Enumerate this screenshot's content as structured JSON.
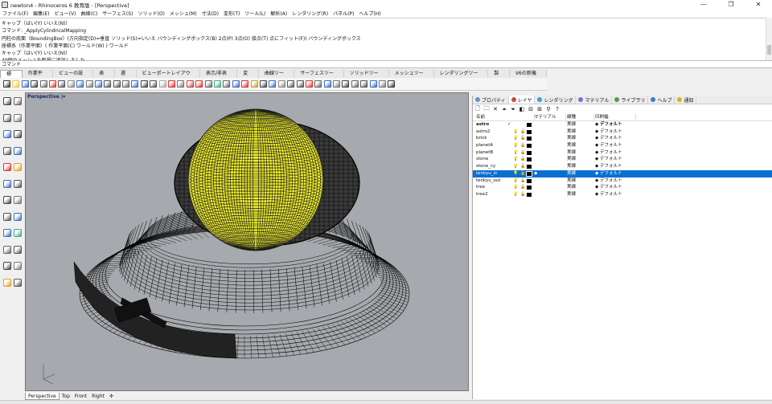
{
  "window": {
    "title": "newton4 - Rhinoceros 6 教育版 - [Perspective]",
    "controls": [
      "—",
      "❐",
      "✕"
    ]
  },
  "menu": [
    "ファイル(F)",
    "編集(E)",
    "ビュー(V)",
    "曲線(C)",
    "サーフェス(S)",
    "ソリッド(O)",
    "メッシュ(M)",
    "寸法(D)",
    "変形(T)",
    "ツール(L)",
    "解析(A)",
    "レンダリング(R)",
    "パネル(P)",
    "ヘルプ(H)"
  ],
  "command_history": [
    "キャップ（はい(Y) いいえ(N)）",
    "コマンド: _ApplyCylindricalMapping",
    "円柱の底面（BoundingBox）(方向指定(D)=垂直 ソリッド(S)=いいえ バウンディングボックス(B) 2点(P) 3点(O) 接点(T) 点にフィット(F)) バウンディングボックス",
    "座標系（作業平面）( 作業平面(C) ワールド(W) ) ワールド",
    "キャップ（はい(Y) いいえ(N)）",
    "49個のメッシュを新規に追加しました。"
  ],
  "command_prompt": "コマンド",
  "toolbar_tabs": [
    {
      "label": "標準",
      "active": true
    },
    {
      "label": "作業平面"
    },
    {
      "label": "ビューの設定"
    },
    {
      "label": "表示"
    },
    {
      "label": "選択"
    },
    {
      "label": "ビューポートレイアウト"
    },
    {
      "label": "表示/非表示"
    },
    {
      "label": "変形"
    },
    {
      "label": "曲線ツール"
    },
    {
      "label": "サーフェスツール"
    },
    {
      "label": "ソリッドツール"
    },
    {
      "label": "メッシュツール"
    },
    {
      "label": "レンダリングツール"
    },
    {
      "label": "製図"
    },
    {
      "label": "V6の新機能"
    }
  ],
  "viewport": {
    "label": "Perspective |▾",
    "tabs": [
      {
        "label": "Perspective",
        "active": true
      },
      {
        "label": "Top"
      },
      {
        "label": "Front"
      },
      {
        "label": "Right"
      },
      {
        "label": "✣"
      }
    ]
  },
  "panel": {
    "tabs": [
      {
        "label": "プロパティ",
        "color": "#6a8fc8"
      },
      {
        "label": "レイヤ",
        "color": "#d24a3a",
        "active": true
      },
      {
        "label": "レンダリング",
        "color": "#3fa0d0"
      },
      {
        "label": "マテリアル",
        "color": "#8a6ac8"
      },
      {
        "label": "ライブラリ",
        "color": "#4aa04a"
      },
      {
        "label": "ヘルプ",
        "color": "#3a7ad0"
      },
      {
        "label": "通知",
        "color": "#e2b020"
      }
    ],
    "tools": [
      "🗋",
      "🗀",
      "✕",
      "⏶",
      "⏷",
      "◧",
      "⊟",
      "⊞",
      "⚲",
      "?"
    ],
    "columns": {
      "name": "名前",
      "material": "マテリアル",
      "linetype": "線種",
      "printwidth": "印刷幅"
    },
    "layers": [
      {
        "name": "astro",
        "current": "✓",
        "on": "",
        "lock": "",
        "material": "",
        "linetype": "実線",
        "printwidth": "デフォルト",
        "bold": true
      },
      {
        "name": "astro2",
        "current": "",
        "on": "💡",
        "lock": "🔓",
        "material": "",
        "linetype": "実線",
        "printwidth": "デフォルト"
      },
      {
        "name": "brick",
        "current": "",
        "on": "💡",
        "lock": "🔓",
        "material": "",
        "linetype": "実線",
        "printwidth": "デフォルト"
      },
      {
        "name": "planetA",
        "current": "",
        "on": "💡",
        "lock": "🔓",
        "material": "",
        "linetype": "実線",
        "printwidth": "デフォルト"
      },
      {
        "name": "planetB",
        "current": "",
        "on": "💡",
        "lock": "🔓",
        "material": "",
        "linetype": "実線",
        "printwidth": "デフォルト"
      },
      {
        "name": "stone",
        "current": "",
        "on": "💡",
        "lock": "🔓",
        "material": "",
        "linetype": "実線",
        "printwidth": "デフォルト"
      },
      {
        "name": "stone_cy",
        "current": "",
        "on": "💡",
        "lock": "🔓",
        "material": "",
        "linetype": "実線",
        "printwidth": "デフォルト"
      },
      {
        "name": "tenkyu_in",
        "current": "",
        "on": "💡",
        "lock": "🔓",
        "material": "◆",
        "linetype": "実線",
        "printwidth": "デフォルト",
        "selected": true
      },
      {
        "name": "tenkyu_out",
        "current": "",
        "on": "💡",
        "lock": "🔓",
        "material": "",
        "linetype": "実線",
        "printwidth": "デフォルト"
      },
      {
        "name": "tree",
        "current": "",
        "on": "💡",
        "lock": "🔓",
        "material": "",
        "linetype": "実線",
        "printwidth": "デフォルト"
      },
      {
        "name": "tree2",
        "current": "",
        "on": "💡",
        "lock": "🔓",
        "material": "",
        "linetype": "実線",
        "printwidth": "デフォルト"
      }
    ]
  },
  "colors": {
    "selection": "#0a6fd0",
    "wire_yellow": "#f2f230",
    "viewport_bg": "#a6a9ad"
  }
}
